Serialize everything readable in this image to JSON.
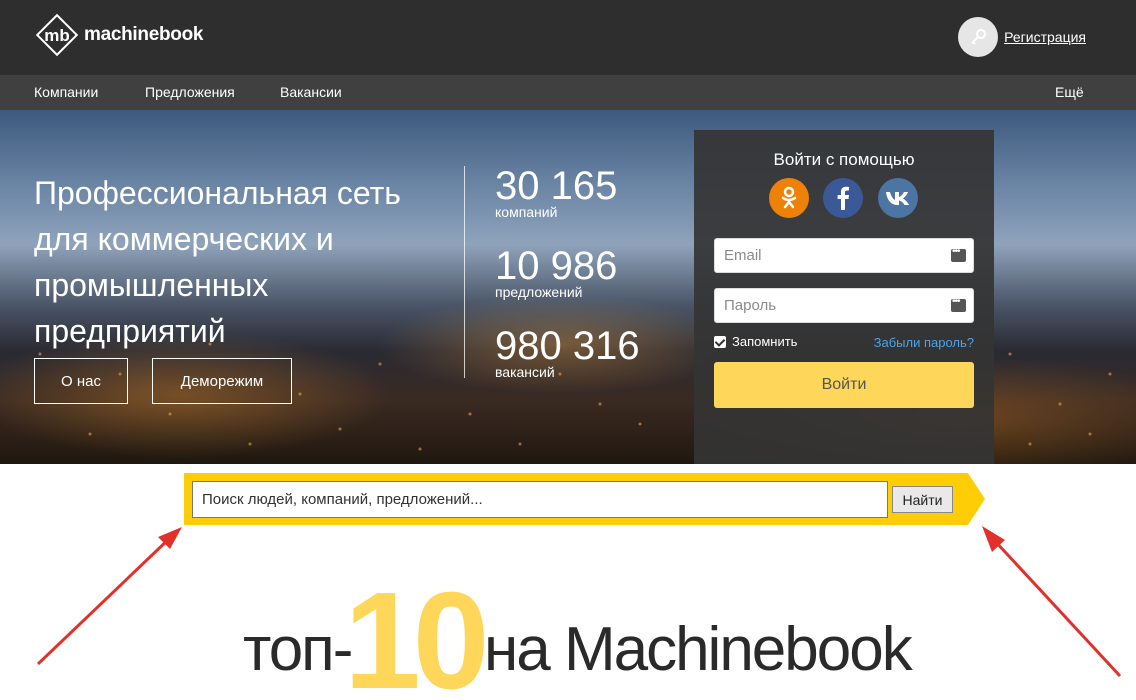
{
  "header": {
    "logo_text": "machinebook",
    "register_label": "Регистрация"
  },
  "nav": {
    "items": [
      {
        "label": "Компании"
      },
      {
        "label": "Предложения"
      },
      {
        "label": "Вакансии"
      }
    ],
    "more_label": "Ещё"
  },
  "hero": {
    "headline": "Профессиональная сеть для коммерческих и промышленных предприятий",
    "stats": [
      {
        "value": "30 165",
        "label": "компаний"
      },
      {
        "value": "10 986",
        "label": "предложений"
      },
      {
        "value": "980 316",
        "label": "вакансий"
      }
    ],
    "about_label": "О нас",
    "demo_label": "Деморежим"
  },
  "login": {
    "title": "Войти с помощью",
    "email_placeholder": "Email",
    "password_placeholder": "Пароль",
    "remember_label": "Запомнить",
    "forgot_label": "Забыли пароль?",
    "submit_label": "Войти",
    "social": [
      {
        "icon": "odnoklassniki-icon",
        "color": "#ee8208"
      },
      {
        "icon": "facebook-icon",
        "color": "#3b5998"
      },
      {
        "icon": "vk-icon",
        "color": "#4c75a3"
      }
    ]
  },
  "search": {
    "placeholder": "Поиск людей, компаний, предложений...",
    "button_label": "Найти"
  },
  "top10": {
    "word1": "топ-",
    "number": "10",
    "word2": "на Machinebook"
  },
  "colors": {
    "accent": "#fdd65a",
    "search_band": "#ffcd05",
    "arrow": "#e2312b",
    "header": "#2e2e2e",
    "nav": "#404040"
  }
}
